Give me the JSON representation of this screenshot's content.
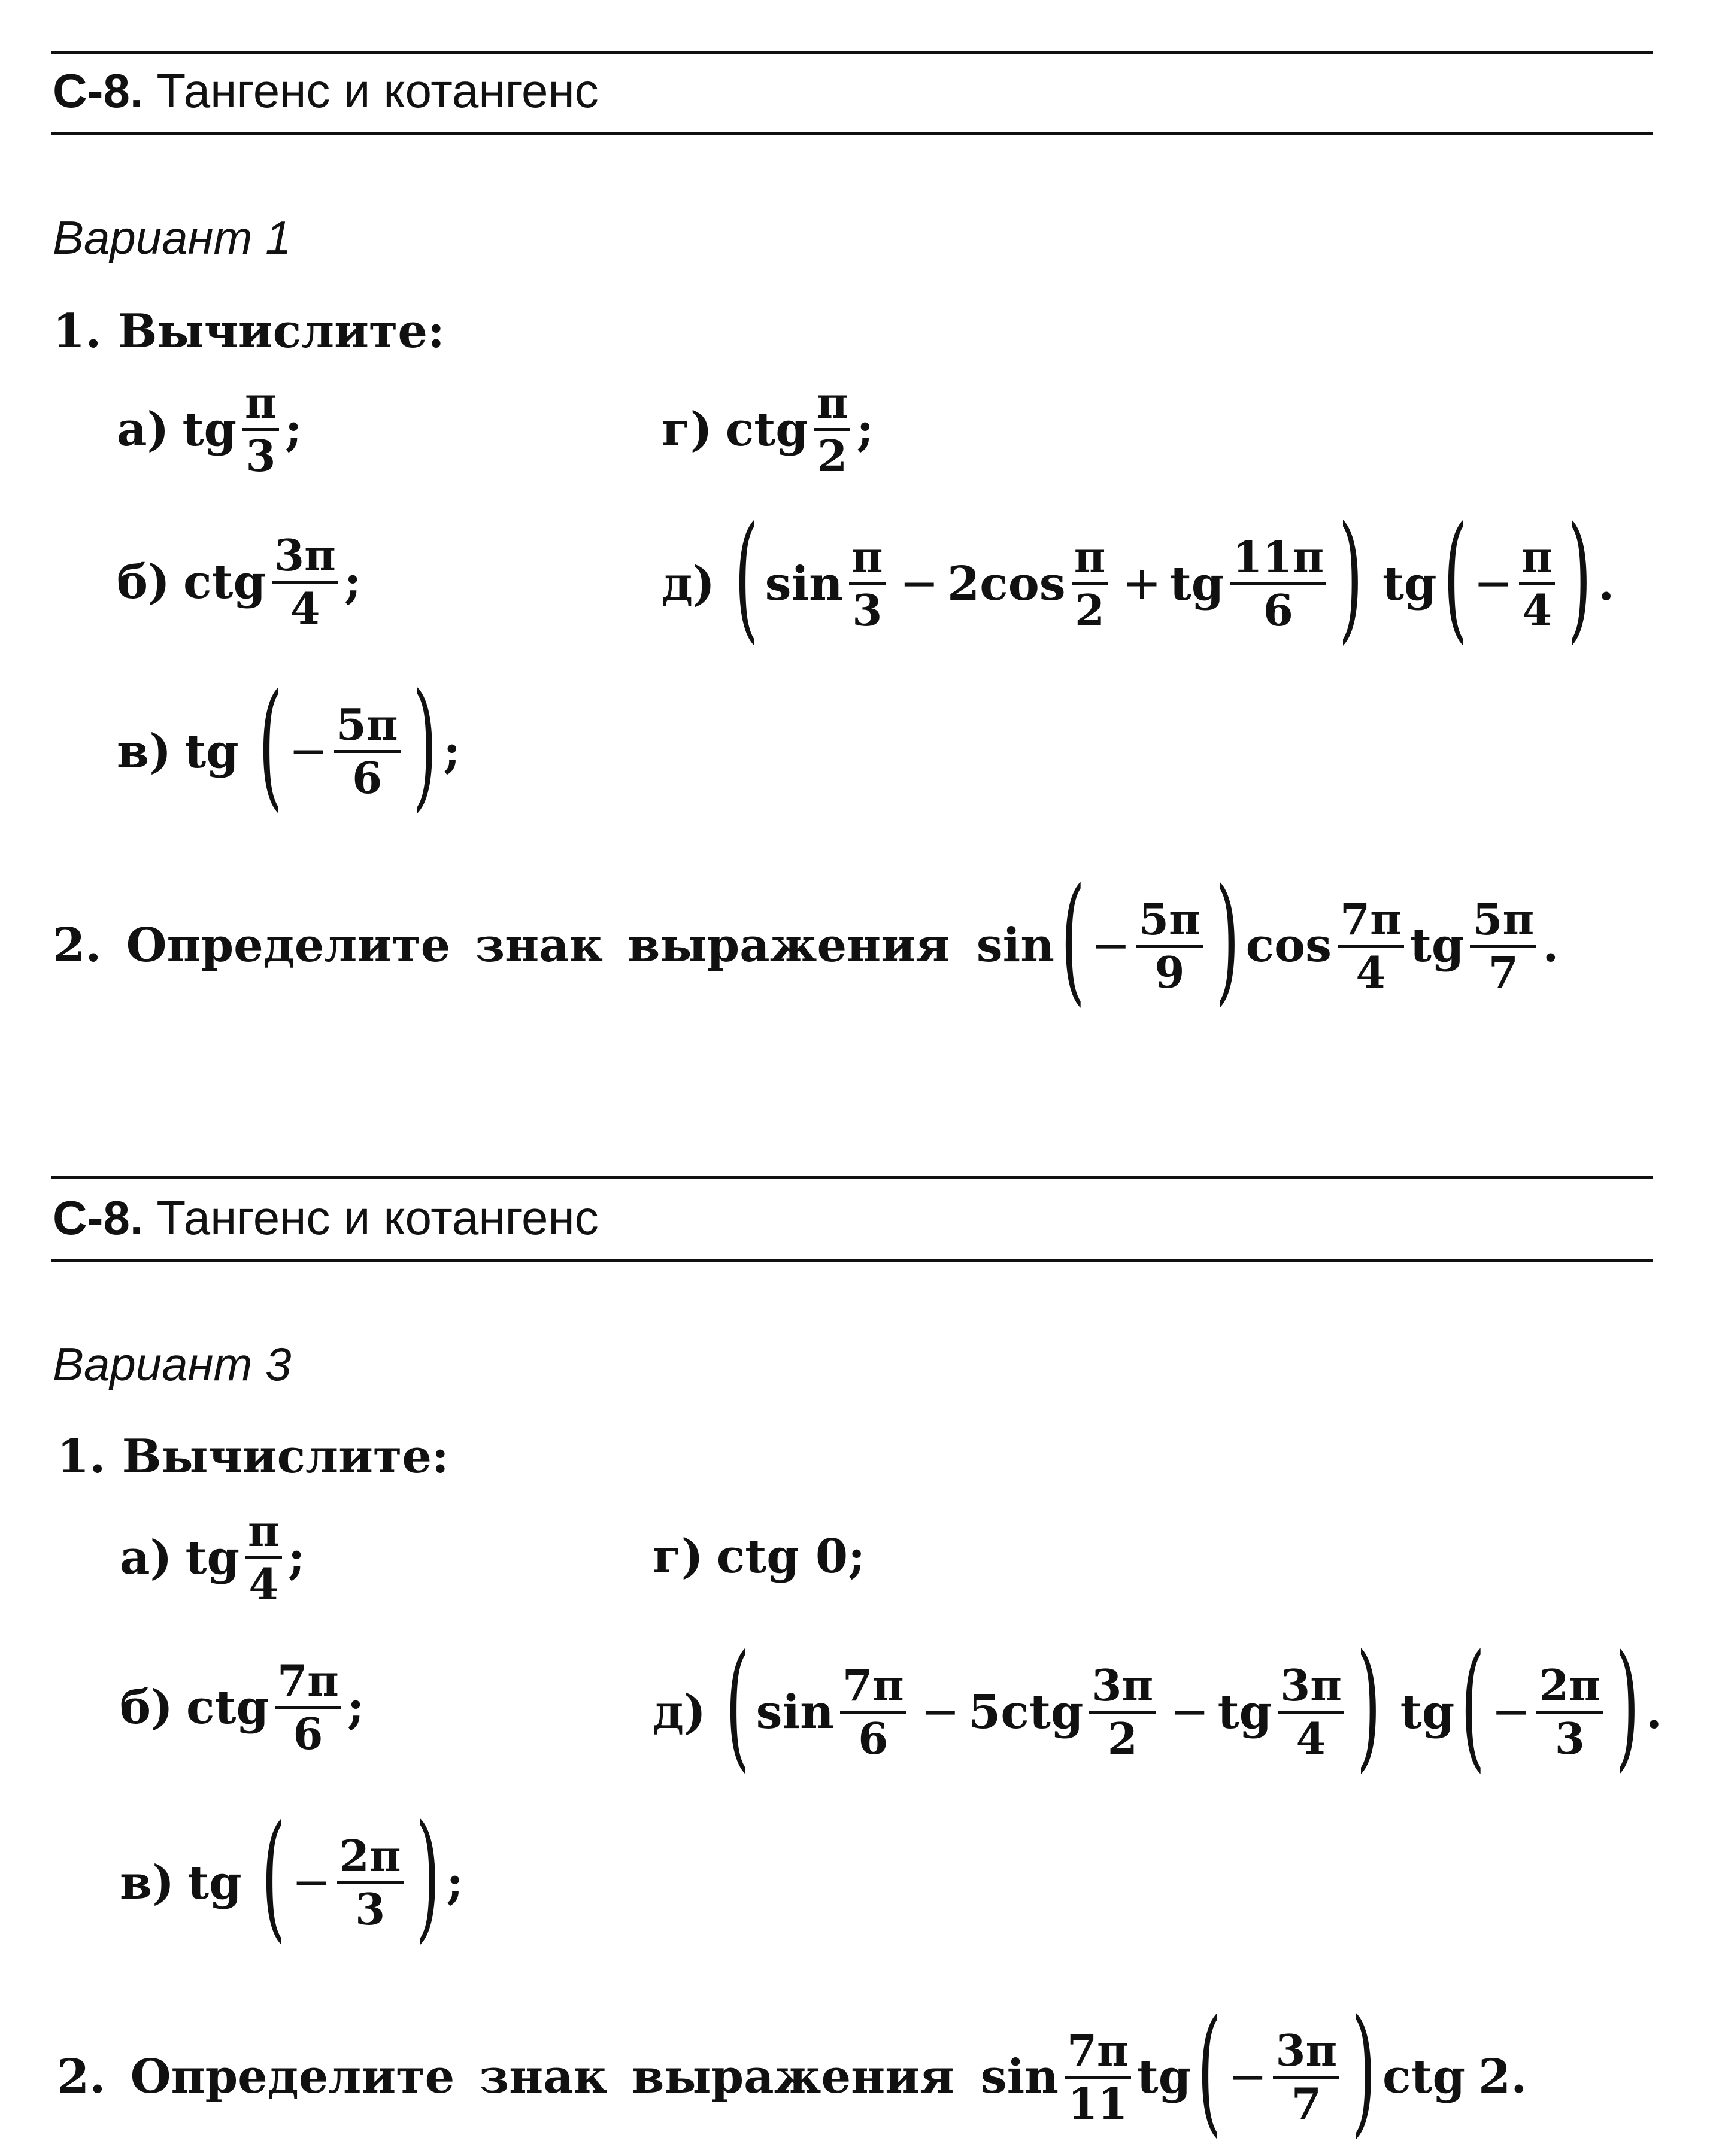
{
  "sections": [
    {
      "code": "С-8.",
      "title": "Тангенс и котангенс",
      "variant": "Вариант 1",
      "task1": {
        "label": "1. Вычислите:",
        "items": {
          "a": {
            "letter": "а)",
            "fn": "tg",
            "num": "π",
            "den": "3",
            "end": ";"
          },
          "b": {
            "letter": "б)",
            "fn": "ctg",
            "num": "3π",
            "den": "4",
            "end": ";"
          },
          "v": {
            "letter": "в)",
            "fn": "tg",
            "sign": "−",
            "num": "5π",
            "den": "6",
            "end": ";"
          },
          "g": {
            "letter": "г)",
            "fn": "ctg",
            "num": "π",
            "den": "2",
            "end": ";"
          },
          "d": {
            "letter": "д)",
            "t1_fn": "sin",
            "t1_num": "π",
            "t1_den": "3",
            "op1": "−",
            "coef": "2",
            "t2_fn": "cos",
            "t2_num": "π",
            "t2_den": "2",
            "op2": "+",
            "t3_fn": "tg",
            "t3_num": "11π",
            "t3_den": "6",
            "outer_fn": "tg",
            "outer_sign": "−",
            "outer_num": "π",
            "outer_den": "4",
            "end": "."
          }
        }
      },
      "task2": {
        "label": "2. Определите знак выражения",
        "f1": "sin",
        "f1_sign": "−",
        "f1_num": "5π",
        "f1_den": "9",
        "f2": "cos",
        "f2_num": "7π",
        "f2_den": "4",
        "f3": "tg",
        "f3_num": "5π",
        "f3_den": "7",
        "end": "."
      }
    },
    {
      "code": "С-8.",
      "title": "Тангенс и котангенс",
      "variant": "Вариант 3",
      "task1": {
        "label": "1. Вычислите:",
        "items": {
          "a": {
            "letter": "а)",
            "fn": "tg",
            "num": "π",
            "den": "4",
            "end": ";"
          },
          "b": {
            "letter": "б)",
            "fn": "ctg",
            "num": "7π",
            "den": "6",
            "end": ";"
          },
          "v": {
            "letter": "в)",
            "fn": "tg",
            "sign": "−",
            "num": "2π",
            "den": "3",
            "end": ";"
          },
          "g": {
            "letter": "г)",
            "expr": "ctg 0;"
          },
          "d": {
            "letter": "д)",
            "t1_fn": "sin",
            "t1_num": "7π",
            "t1_den": "6",
            "op1": "−",
            "coef": "5",
            "t2_fn": "ctg",
            "t2_num": "3π",
            "t2_den": "2",
            "op2": "−",
            "t3_fn": "tg",
            "t3_num": "3π",
            "t3_den": "4",
            "outer_fn": "tg",
            "outer_sign": "−",
            "outer_num": "2π",
            "outer_den": "3",
            "end": "."
          }
        }
      },
      "task2": {
        "label": "2. Определите знак выражения",
        "f1": "sin",
        "f1_num": "7π",
        "f1_den": "11",
        "f2": "tg",
        "f2_sign": "−",
        "f2_num": "3π",
        "f2_den": "7",
        "f3": "ctg",
        "f3_arg": "2",
        "end": "."
      }
    }
  ]
}
